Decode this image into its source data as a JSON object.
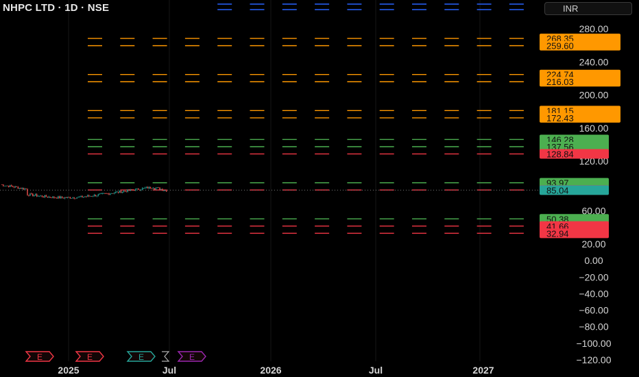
{
  "header": {
    "symbol_title": "NHPC LTD · 1D · NSE",
    "currency": "INR"
  },
  "colors": {
    "orange": "#ff9800",
    "green": "#4caf50",
    "red": "#f23645",
    "teal": "#26a69a",
    "blue": "#2962ff",
    "price_line": "#7a7a7a"
  },
  "chart_data": {
    "type": "line",
    "ylim": [
      -120,
      280
    ],
    "y_ticks": [
      "280.00",
      "240.00",
      "200.00",
      "160.00",
      "120.00",
      "60.00",
      "20.00",
      "0.00",
      "−20.00",
      "−40.00",
      "−60.00",
      "−80.00",
      "−100.00",
      "−120.00"
    ],
    "y_tick_values": [
      280,
      240,
      200,
      160,
      120,
      60,
      20,
      0,
      -20,
      -40,
      -60,
      -80,
      -100,
      -120
    ],
    "x_labels": [
      "2025",
      "Jul",
      "2026",
      "Jul",
      "2027"
    ],
    "current_price": {
      "value": 85.04,
      "label": "85.04"
    },
    "level_tags": [
      {
        "value": 268.35,
        "label": "268.35",
        "color": "orange"
      },
      {
        "value": 259.6,
        "label": "259.60",
        "color": "orange"
      },
      {
        "value": 224.74,
        "label": "224.74",
        "color": "orange"
      },
      {
        "value": 216.03,
        "label": "216.03",
        "color": "orange"
      },
      {
        "value": 181.15,
        "label": "181.15",
        "color": "orange"
      },
      {
        "value": 172.43,
        "label": "172.43",
        "color": "orange"
      },
      {
        "value": 146.28,
        "label": "146.28",
        "color": "green"
      },
      {
        "value": 137.56,
        "label": "137.56",
        "color": "green"
      },
      {
        "value": 128.84,
        "label": "128.84",
        "color": "red"
      },
      {
        "value": 93.97,
        "label": "93.97",
        "color": "green"
      },
      {
        "value": 85.25,
        "label": "85.25",
        "color": "red"
      },
      {
        "value": 50.38,
        "label": "50.38",
        "color": "green"
      },
      {
        "value": 41.66,
        "label": "41.66",
        "color": "red"
      },
      {
        "value": 32.94,
        "label": "32.94",
        "color": "red"
      }
    ],
    "event_markers": [
      {
        "label": "E",
        "color": "red"
      },
      {
        "label": "E",
        "color": "red"
      },
      {
        "label": "E",
        "color": "teal"
      },
      {
        "label": "E",
        "color": "purple"
      }
    ]
  }
}
